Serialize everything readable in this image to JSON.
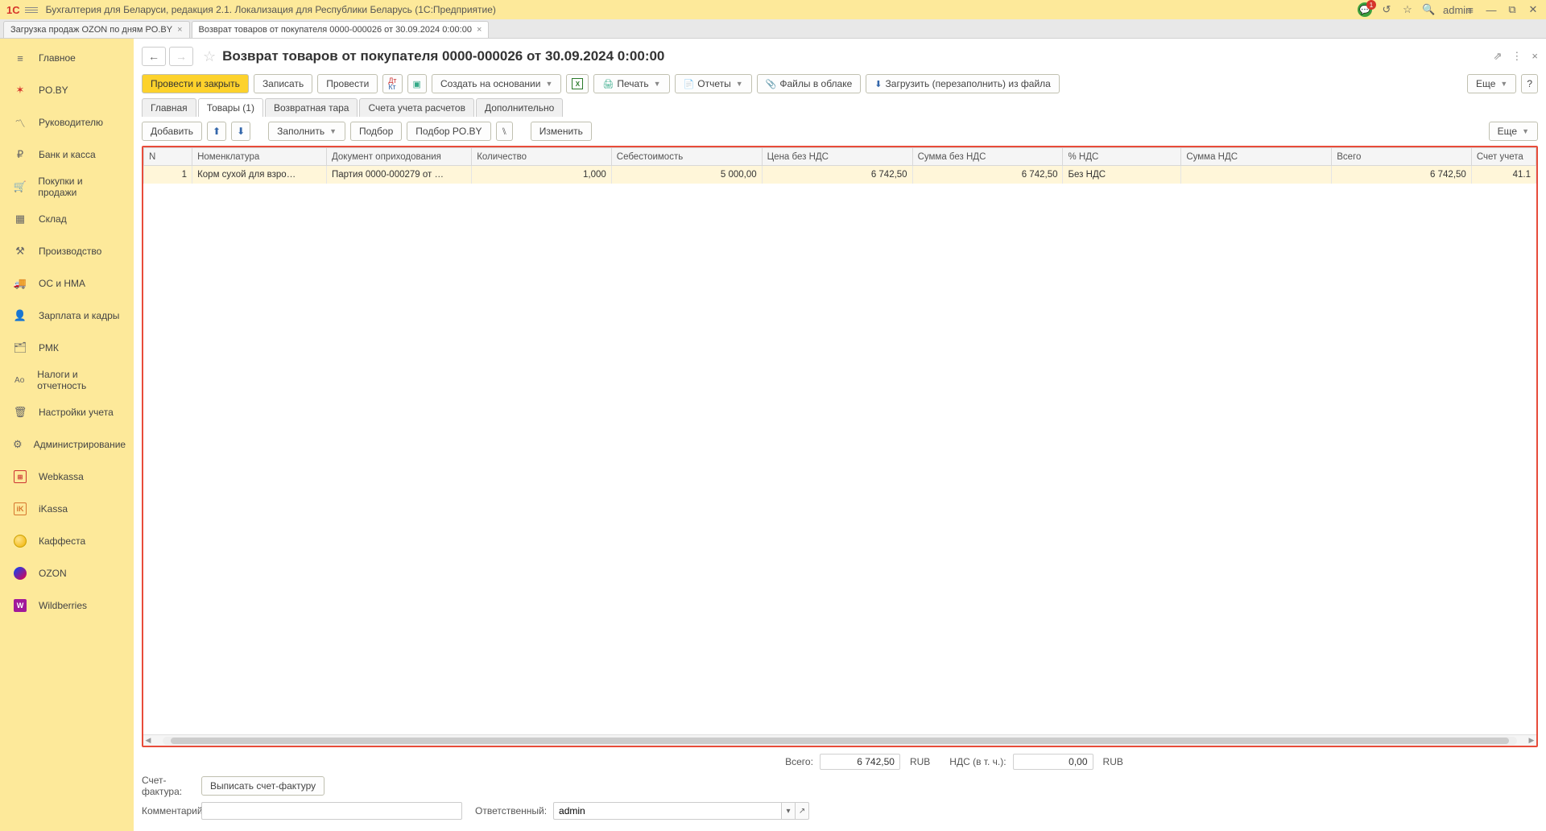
{
  "titlebar": {
    "app_title": "Бухгалтерия для Беларуси, редакция 2.1. Локализация для Республики Беларусь  (1С:Предприятие)",
    "logo": "1С",
    "user": "admin",
    "bell_count": "1"
  },
  "tabs": [
    {
      "label": "Загрузка продаж OZON по дням PO.BY",
      "active": false
    },
    {
      "label": "Возврат товаров от покупателя 0000-000026 от 30.09.2024 0:00:00",
      "active": true
    }
  ],
  "sidebar": [
    {
      "label": "Главное",
      "icon": "≡"
    },
    {
      "label": "PO.BY",
      "icon": "✶"
    },
    {
      "label": "Руководителю",
      "icon": "📈"
    },
    {
      "label": "Банк и касса",
      "icon": "₽"
    },
    {
      "label": "Покупки и продажи",
      "icon": "🛒"
    },
    {
      "label": "Склад",
      "icon": "▦"
    },
    {
      "label": "Производство",
      "icon": "⚚"
    },
    {
      "label": "ОС и НМА",
      "icon": "🚚"
    },
    {
      "label": "Зарплата и кадры",
      "icon": "👤"
    },
    {
      "label": "РМК",
      "icon": "🗂"
    },
    {
      "label": "Налоги и отчетность",
      "icon": "Ао"
    },
    {
      "label": "Настройки учета",
      "icon": "🗑"
    },
    {
      "label": "Администрирование",
      "icon": "⚙"
    },
    {
      "label": "Webkassa",
      "icon": "wk"
    },
    {
      "label": "iKassa",
      "icon": "iK"
    },
    {
      "label": "Каффеста",
      "icon": "kaffesta"
    },
    {
      "label": "OZON",
      "icon": "ozon"
    },
    {
      "label": "Wildberries",
      "icon": "W"
    }
  ],
  "page": {
    "title": "Возврат товаров от покупателя 0000-000026 от 30.09.2024 0:00:00",
    "more_label": "Еще"
  },
  "commands": {
    "post_close": "Провести и закрыть",
    "write": "Записать",
    "post": "Провести",
    "create_based": "Создать на основании",
    "print": "Печать",
    "reports": "Отчеты",
    "cloud_files": "Файлы в облаке",
    "load_file": "Загрузить (перезаполнить) из файла",
    "more": "Еще"
  },
  "doc_tabs": [
    {
      "label": "Главная"
    },
    {
      "label": "Товары (1)",
      "active": true
    },
    {
      "label": "Возвратная тара"
    },
    {
      "label": "Счета учета расчетов"
    },
    {
      "label": "Дополнительно"
    }
  ],
  "table_toolbar": {
    "add": "Добавить",
    "fill": "Заполнить",
    "pick": "Подбор",
    "pick_poby": "Подбор PO.BY",
    "edit": "Изменить",
    "more": "Еще"
  },
  "table": {
    "columns": [
      "N",
      "Номенклатура",
      "Документ оприходования",
      "Количество",
      "Себестоимость",
      "Цена без НДС",
      "Сумма без НДС",
      "% НДС",
      "Сумма НДС",
      "Всего",
      "Счет учета"
    ],
    "rows": [
      {
        "n": "1",
        "nomen": "Корм сухой для взро…",
        "doc": "Партия 0000-000279 от …",
        "qty": "1,000",
        "cost": "5 000,00",
        "price": "6 742,50",
        "sum": "6 742,50",
        "vat_pct": "Без НДС",
        "vat_sum": "",
        "total": "6 742,50",
        "account": "41.1"
      }
    ]
  },
  "footer": {
    "total_label": "Всего:",
    "total_value": "6 742,50",
    "currency": "RUB",
    "vat_label": "НДС (в т. ч.):",
    "vat_value": "0,00",
    "invoice_label": "Счет-фактура:",
    "write_invoice_btn": "Выписать счет-фактуру",
    "comment_label": "Комментарий:",
    "responsible_label": "Ответственный:",
    "responsible_value": "admin"
  }
}
